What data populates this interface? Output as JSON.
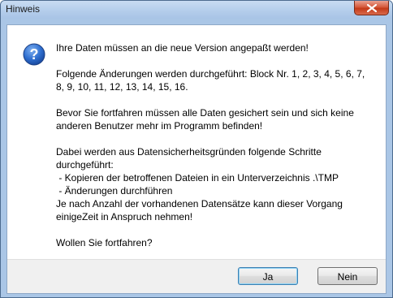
{
  "window": {
    "title": "Hinweis",
    "close_icon": "close-icon"
  },
  "icon": "question-icon",
  "message": {
    "line1": "Ihre Daten müssen an die neue Version angepaßt werden!",
    "para2_line1": "Folgende Änderungen werden durchgeführt: Block Nr. 1, 2, 3, 4, 5, 6, 7,",
    "para2_line2": "8, 9, 10, 11, 12, 13, 14, 15, 16.",
    "para3_line1": "Bevor Sie fortfahren müssen alle Daten gesichert sein und sich keine",
    "para3_line2": "anderen Benutzer mehr im Programm befinden!",
    "para4_line1": "Dabei werden aus Datensicherheitsgründen folgende Schritte",
    "para4_line2": "durchgeführt:",
    "para4_line3": " - Kopieren der betroffenen Dateien in ein Unterverzeichnis .\\TMP",
    "para4_line4": " - Änderungen durchführen",
    "para4_line5": "Je nach Anzahl der vorhandenen Datensätze kann dieser Vorgang",
    "para4_line6": "einigeZeit in Anspruch nehmen!",
    "question": "Wollen Sie fortfahren?"
  },
  "buttons": {
    "yes": "Ja",
    "no": "Nein"
  }
}
